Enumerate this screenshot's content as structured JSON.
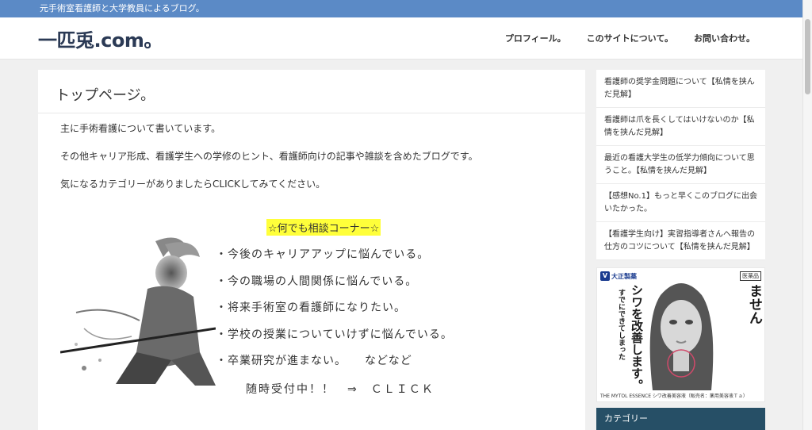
{
  "topbar": {
    "tagline": "元手術室看護師と大学教員によるブログ。"
  },
  "header": {
    "site_title": "一匹兎.com。",
    "nav": [
      "プロフィール。",
      "このサイトについて。",
      "お問い合わせ。"
    ]
  },
  "main": {
    "page_title": "トップページ。",
    "paragraphs": [
      "主に手術看護について書いています。",
      "その他キャリア形成、看護学生への学修のヒント、看護師向けの記事や雑談を含めたブログです。",
      "気になるカテゴリーがありましたらCLICKしてみてください。"
    ],
    "consult": {
      "heading": "☆何でも相談コーナー☆",
      "items": [
        "・今後のキャリアアップに悩んでいる。",
        "・今の職場の人間関係に悩んでいる。",
        "・将来手術室の看護師になりたい。",
        "・学校の授業についていけずに悩んでいる。",
        "・卒業研究が進まない。　　などなど"
      ],
      "note": "随時受付中！！　⇒　ＣＬＩＣＫ"
    }
  },
  "sidebar": {
    "recent_posts": [
      "看護師の奨学金問題について【私情を挟んだ見解】",
      "看護師は爪を長くしてはいけないのか【私情を挟んだ見解】",
      "最近の看護大学生の低学力傾向について思うこと。【私情を挟んだ見解】",
      "【感想No.1】もっと早くこのブログに出会いたかった。",
      "【看護学生向け】実習指導者さんへ報告の仕方のコツについて【私情を挟んだ見解】"
    ],
    "ad": {
      "brand": "大正製薬",
      "badge": "医薬品",
      "col1": "シワ予防ではありません",
      "col2": "シワを改善します。",
      "col3": "すでにできてしまった",
      "foot": "THE MYTOL ESSENCE シワ改善美容液（販売名：薬用美容液Ｔａ）"
    },
    "category_heading": "カテゴリー"
  },
  "colors": {
    "topbar": "#5b8ac6",
    "site_title": "#2b3a55",
    "highlight": "#ffff3a",
    "category_header": "#264f66"
  }
}
